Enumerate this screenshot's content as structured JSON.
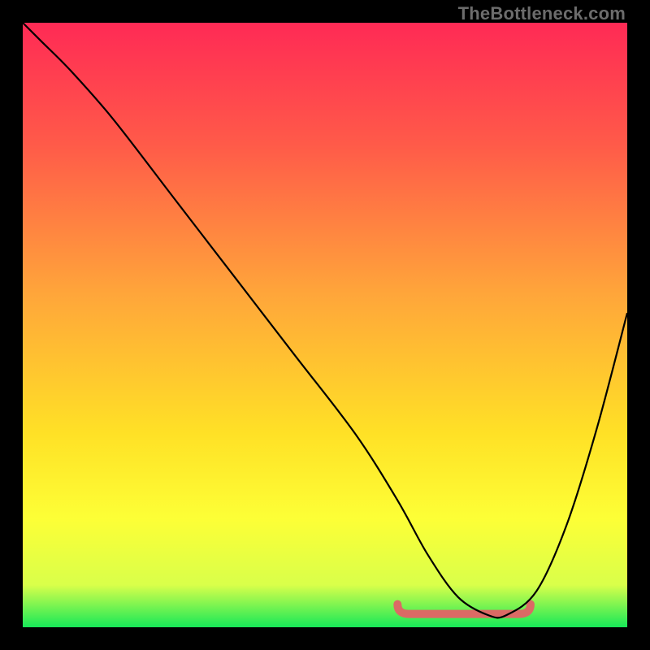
{
  "watermark": "TheBottleneck.com",
  "chart_data": {
    "type": "line",
    "title": "",
    "xlabel": "",
    "ylabel": "",
    "xlim": [
      0,
      100
    ],
    "ylim": [
      0,
      100
    ],
    "background_gradient": {
      "stops": [
        {
          "offset": 0.0,
          "color": "#ff2a55"
        },
        {
          "offset": 0.2,
          "color": "#ff5a49"
        },
        {
          "offset": 0.45,
          "color": "#ffa63a"
        },
        {
          "offset": 0.68,
          "color": "#ffe126"
        },
        {
          "offset": 0.82,
          "color": "#fdff36"
        },
        {
          "offset": 0.93,
          "color": "#d9ff4a"
        },
        {
          "offset": 1.0,
          "color": "#17e858"
        }
      ]
    },
    "series": [
      {
        "name": "bottleneck-curve",
        "color": "#000000",
        "width": 2.2,
        "x": [
          0,
          3,
          8,
          15,
          25,
          35,
          45,
          55,
          62,
          67,
          72,
          77,
          80,
          85,
          90,
          95,
          100
        ],
        "values": [
          100,
          97,
          92,
          84,
          71,
          58,
          45,
          32,
          21,
          12,
          5,
          2,
          2,
          6,
          17,
          33,
          52
        ]
      }
    ],
    "highlight_band": {
      "name": "optimal-range",
      "color": "#db6a65",
      "width": 10,
      "x_start": 62,
      "x_end": 84,
      "y_level": 2.2
    }
  }
}
